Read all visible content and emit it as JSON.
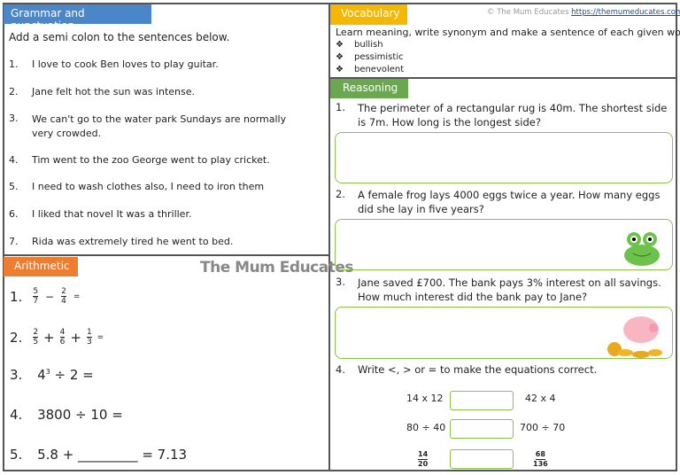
{
  "grammar": {
    "title": "Grammar and punctuation",
    "instruction": "Add a semi colon to the sentences below.",
    "items": [
      {
        "n": "1.",
        "text": "I love to cook Ben loves to play guitar."
      },
      {
        "n": "2.",
        "text": "Jane felt hot the sun was intense."
      },
      {
        "n": "3.",
        "text": "We can't go to the water park Sundays are normally very crowded."
      },
      {
        "n": "4.",
        "text": "Tim went to the zoo George went to play cricket."
      },
      {
        "n": "5.",
        "text": "I need to wash clothes also, I need to iron them"
      },
      {
        "n": "6.",
        "text": "I liked that novel It was a thriller."
      },
      {
        "n": "7.",
        "text": "Rida was extremely tired he went to bed."
      }
    ]
  },
  "arithmetic": {
    "title": "Arithmetic",
    "logo": "The Mum Educates",
    "q1": {
      "n": "1.",
      "a_num": "5",
      "a_den": "7",
      "op": "−",
      "b_num": "2",
      "b_den": "4",
      "eq": "="
    },
    "q2": {
      "n": "2.",
      "a_num": "2",
      "a_den": "5",
      "op1": "+",
      "b_num": "4",
      "b_den": "6",
      "op2": "+",
      "c_num": "1",
      "c_den": "3",
      "eq": "="
    },
    "q3": {
      "n": "3.",
      "base": "4",
      "exp": "3",
      "rest": "÷ 2 ="
    },
    "q4": {
      "n": "4.",
      "text": "3800 ÷ 10 ="
    },
    "q5": {
      "n": "5.",
      "text": "5.8 + _________ = 7.13"
    }
  },
  "vocabulary": {
    "title": "Vocabulary",
    "copyright": "© The Mum Educates",
    "link": "https://themumeducates.com/",
    "instruction": "Learn meaning, write synonym and make a sentence of each given word.",
    "bullet": "❖",
    "words": [
      "bullish",
      "pessimistic",
      "benevolent"
    ]
  },
  "reasoning": {
    "title": "Reasoning",
    "q1": {
      "n": "1.",
      "text": "The perimeter of a rectangular rug is 40m. The shortest side is 7m. How long is the longest side?"
    },
    "q2": {
      "n": "2.",
      "text": "A female frog lays 4000 eggs twice a year. How many eggs did she lay in five years?"
    },
    "q3": {
      "n": "3.",
      "text": "Jane saved £700. The bank pays 3% interest on all savings. How much interest did the bank pay to Jane?"
    },
    "q4": {
      "n": "4.",
      "text": "Write <, > or = to make the equations correct.",
      "rows": [
        {
          "left": "14 x 12",
          "right": "42 x 4"
        },
        {
          "left": "80 ÷ 40",
          "right": "700 ÷ 70"
        }
      ],
      "frac_row": {
        "l_num": "14",
        "l_den": "20",
        "r_num": "68",
        "r_den": "136"
      }
    }
  },
  "colors": {
    "grammar": "#4a86c8",
    "arithmetic": "#ed7d31",
    "vocabulary": "#f5b800",
    "reasoning": "#6aa84f",
    "answer_box": "#8bc34a"
  }
}
